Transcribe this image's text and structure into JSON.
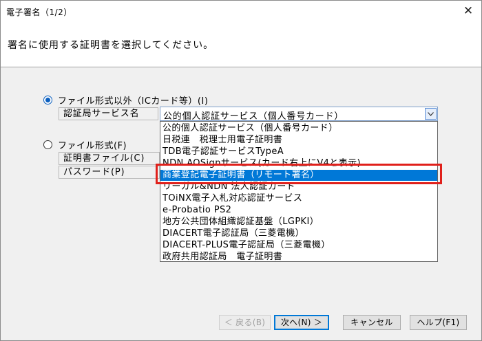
{
  "window": {
    "title": "電子署名（1/2）",
    "close_glyph": "✕"
  },
  "header": {
    "instruction": "署名に使用する証明書を選択してください。"
  },
  "options": {
    "ic_card": {
      "label": "ファイル形式以外（ICカード等）(I)",
      "checked": true,
      "authority_label": "認証局サービス名",
      "authority_selected": "公的個人認証サービス（個人番号カード）"
    },
    "file": {
      "label": "ファイル形式(F)",
      "checked": false,
      "cert_file_label": "証明書ファイル(C)",
      "password_label": "パスワード(P)"
    }
  },
  "dropdown": {
    "items": [
      "公的個人認証サービス（個人番号カード）",
      "日税連　税理士用電子証明書",
      "TDB電子認証サービスTypeA",
      "NDN AOSignサービス(カード右上にV4と表示)",
      "商業登記電子証明書（リモート署名）",
      "リーガル&NDN 法人認証カード",
      "TOiNX電子入札対応認証サービス",
      "e-Probatio PS2",
      "地方公共団体組織認証基盤（LGPKI）",
      "DIACERT電子認証局（三菱電機）",
      "DIACERT-PLUS電子認証局（三菱電機）",
      "政府共用認証局　電子証明書"
    ],
    "highlighted": "商業登記電子証明書（リモート署名）"
  },
  "buttons": {
    "back": "＜ 戻る(B)",
    "next": "次へ(N) ＞",
    "cancel": "キャンセル",
    "help": "ヘルプ(F1)"
  },
  "colors": {
    "selection": "#0078d7",
    "annotation": "#e0201b"
  }
}
